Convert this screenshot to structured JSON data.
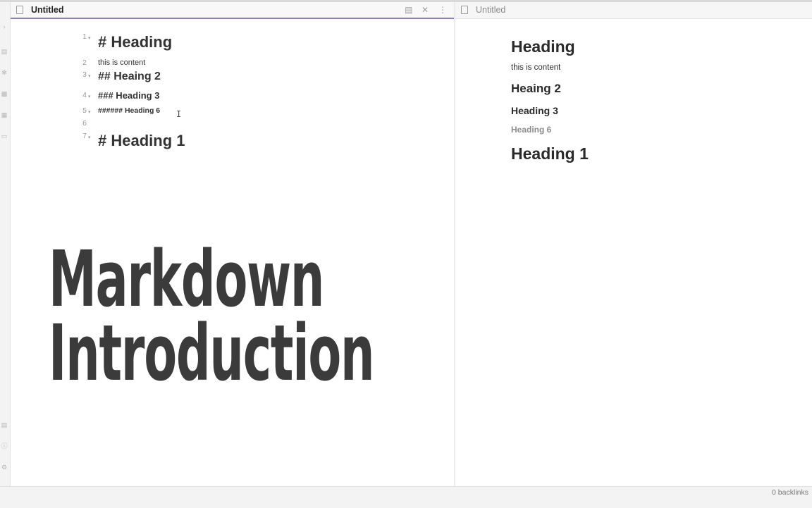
{
  "left_pane": {
    "title": "Untitled",
    "actions": [
      "book-icon",
      "close-icon",
      "more-vertical-icon"
    ],
    "lines": [
      {
        "num": "1",
        "text": "# Heading",
        "kind": "h1",
        "foldable": true
      },
      {
        "num": "2",
        "text": "this is content",
        "kind": "txt",
        "foldable": false
      },
      {
        "num": "3",
        "text": "## Heaing 2",
        "kind": "h2",
        "foldable": true
      },
      {
        "num": "4",
        "text": "### Heading 3",
        "kind": "h3",
        "foldable": true
      },
      {
        "num": "5",
        "text": "###### Heading 6",
        "kind": "h6",
        "foldable": true
      },
      {
        "num": "6",
        "text": "",
        "kind": "txt",
        "foldable": false
      },
      {
        "num": "7",
        "text": "# Heading 1",
        "kind": "h1",
        "foldable": true
      }
    ]
  },
  "overlay": {
    "line1": "Markdown",
    "line2": "Introduction"
  },
  "right_pane": {
    "title": "Untitled",
    "preview": [
      {
        "text": "Heading",
        "kind": "h1"
      },
      {
        "text": "this is content",
        "kind": "txt"
      },
      {
        "text": "Heaing 2",
        "kind": "h2"
      },
      {
        "text": "Heading 3",
        "kind": "h3"
      },
      {
        "text": "Heading 6",
        "kind": "h6"
      },
      {
        "text": "Heading 1",
        "kind": "h1"
      }
    ]
  },
  "status": {
    "backlinks": "0 backlinks"
  },
  "ribbon": {
    "icons": [
      "expand-chevron-icon",
      "files-icon",
      "graph-icon",
      "plugins-icon",
      "calendar-icon",
      "inbox-icon",
      "vault-icon",
      "help-icon",
      "settings-icon"
    ]
  }
}
